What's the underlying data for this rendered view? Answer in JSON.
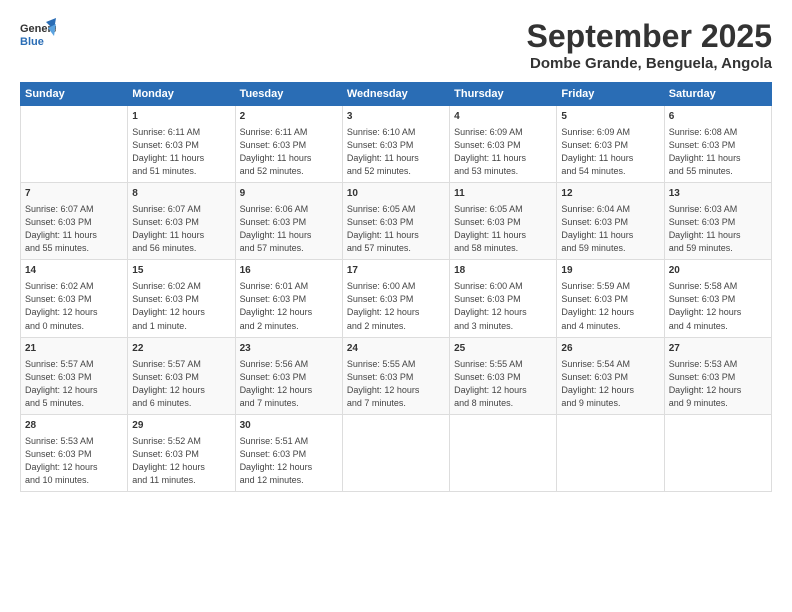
{
  "logo": {
    "line1": "General",
    "line2": "Blue"
  },
  "title": "September 2025",
  "subtitle": "Dombe Grande, Benguela, Angola",
  "headers": [
    "Sunday",
    "Monday",
    "Tuesday",
    "Wednesday",
    "Thursday",
    "Friday",
    "Saturday"
  ],
  "weeks": [
    [
      {
        "day": "",
        "info": ""
      },
      {
        "day": "1",
        "info": "Sunrise: 6:11 AM\nSunset: 6:03 PM\nDaylight: 11 hours\nand 51 minutes."
      },
      {
        "day": "2",
        "info": "Sunrise: 6:11 AM\nSunset: 6:03 PM\nDaylight: 11 hours\nand 52 minutes."
      },
      {
        "day": "3",
        "info": "Sunrise: 6:10 AM\nSunset: 6:03 PM\nDaylight: 11 hours\nand 52 minutes."
      },
      {
        "day": "4",
        "info": "Sunrise: 6:09 AM\nSunset: 6:03 PM\nDaylight: 11 hours\nand 53 minutes."
      },
      {
        "day": "5",
        "info": "Sunrise: 6:09 AM\nSunset: 6:03 PM\nDaylight: 11 hours\nand 54 minutes."
      },
      {
        "day": "6",
        "info": "Sunrise: 6:08 AM\nSunset: 6:03 PM\nDaylight: 11 hours\nand 55 minutes."
      }
    ],
    [
      {
        "day": "7",
        "info": "Sunrise: 6:07 AM\nSunset: 6:03 PM\nDaylight: 11 hours\nand 55 minutes."
      },
      {
        "day": "8",
        "info": "Sunrise: 6:07 AM\nSunset: 6:03 PM\nDaylight: 11 hours\nand 56 minutes."
      },
      {
        "day": "9",
        "info": "Sunrise: 6:06 AM\nSunset: 6:03 PM\nDaylight: 11 hours\nand 57 minutes."
      },
      {
        "day": "10",
        "info": "Sunrise: 6:05 AM\nSunset: 6:03 PM\nDaylight: 11 hours\nand 57 minutes."
      },
      {
        "day": "11",
        "info": "Sunrise: 6:05 AM\nSunset: 6:03 PM\nDaylight: 11 hours\nand 58 minutes."
      },
      {
        "day": "12",
        "info": "Sunrise: 6:04 AM\nSunset: 6:03 PM\nDaylight: 11 hours\nand 59 minutes."
      },
      {
        "day": "13",
        "info": "Sunrise: 6:03 AM\nSunset: 6:03 PM\nDaylight: 11 hours\nand 59 minutes."
      }
    ],
    [
      {
        "day": "14",
        "info": "Sunrise: 6:02 AM\nSunset: 6:03 PM\nDaylight: 12 hours\nand 0 minutes."
      },
      {
        "day": "15",
        "info": "Sunrise: 6:02 AM\nSunset: 6:03 PM\nDaylight: 12 hours\nand 1 minute."
      },
      {
        "day": "16",
        "info": "Sunrise: 6:01 AM\nSunset: 6:03 PM\nDaylight: 12 hours\nand 2 minutes."
      },
      {
        "day": "17",
        "info": "Sunrise: 6:00 AM\nSunset: 6:03 PM\nDaylight: 12 hours\nand 2 minutes."
      },
      {
        "day": "18",
        "info": "Sunrise: 6:00 AM\nSunset: 6:03 PM\nDaylight: 12 hours\nand 3 minutes."
      },
      {
        "day": "19",
        "info": "Sunrise: 5:59 AM\nSunset: 6:03 PM\nDaylight: 12 hours\nand 4 minutes."
      },
      {
        "day": "20",
        "info": "Sunrise: 5:58 AM\nSunset: 6:03 PM\nDaylight: 12 hours\nand 4 minutes."
      }
    ],
    [
      {
        "day": "21",
        "info": "Sunrise: 5:57 AM\nSunset: 6:03 PM\nDaylight: 12 hours\nand 5 minutes."
      },
      {
        "day": "22",
        "info": "Sunrise: 5:57 AM\nSunset: 6:03 PM\nDaylight: 12 hours\nand 6 minutes."
      },
      {
        "day": "23",
        "info": "Sunrise: 5:56 AM\nSunset: 6:03 PM\nDaylight: 12 hours\nand 7 minutes."
      },
      {
        "day": "24",
        "info": "Sunrise: 5:55 AM\nSunset: 6:03 PM\nDaylight: 12 hours\nand 7 minutes."
      },
      {
        "day": "25",
        "info": "Sunrise: 5:55 AM\nSunset: 6:03 PM\nDaylight: 12 hours\nand 8 minutes."
      },
      {
        "day": "26",
        "info": "Sunrise: 5:54 AM\nSunset: 6:03 PM\nDaylight: 12 hours\nand 9 minutes."
      },
      {
        "day": "27",
        "info": "Sunrise: 5:53 AM\nSunset: 6:03 PM\nDaylight: 12 hours\nand 9 minutes."
      }
    ],
    [
      {
        "day": "28",
        "info": "Sunrise: 5:53 AM\nSunset: 6:03 PM\nDaylight: 12 hours\nand 10 minutes."
      },
      {
        "day": "29",
        "info": "Sunrise: 5:52 AM\nSunset: 6:03 PM\nDaylight: 12 hours\nand 11 minutes."
      },
      {
        "day": "30",
        "info": "Sunrise: 5:51 AM\nSunset: 6:03 PM\nDaylight: 12 hours\nand 12 minutes."
      },
      {
        "day": "",
        "info": ""
      },
      {
        "day": "",
        "info": ""
      },
      {
        "day": "",
        "info": ""
      },
      {
        "day": "",
        "info": ""
      }
    ]
  ]
}
